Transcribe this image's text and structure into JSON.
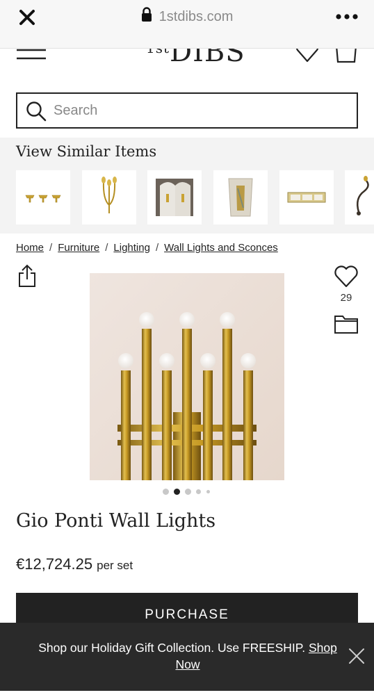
{
  "browser": {
    "url": "1stdibs.com",
    "icons": {
      "close": "close-icon",
      "lock": "lock-icon",
      "more": "more-icon"
    }
  },
  "header": {
    "logo_prefix": "1st",
    "logo_main": "DIBS",
    "icons": [
      "menu-icon",
      "heart-icon",
      "shopping-bag-icon"
    ]
  },
  "search": {
    "placeholder": "Search",
    "value": ""
  },
  "similar": {
    "title": "View Similar Items",
    "items": [
      "three-arm-sconce-set",
      "brass-triple-candle-sconce",
      "sconces-against-white-wall",
      "glass-panel-sconce",
      "horizontal-brass-bar-light",
      "curved-arm-sconce"
    ]
  },
  "breadcrumb": {
    "items": [
      "Home",
      "Furniture",
      "Lighting",
      "Wall Lights and Sconces"
    ],
    "separator": "/"
  },
  "product": {
    "favorites_count": "29",
    "title": "Gio Ponti Wall Lights",
    "price": "€12,724.25",
    "price_unit": "per set",
    "purchase_label": "PURCHASE",
    "image_index": 2,
    "image_count": 5
  },
  "promo": {
    "text": "Shop our Holiday Gift Collection. Use FREESHIP.",
    "link_label": "Shop Now"
  },
  "colors": {
    "dark": "#222222",
    "banner": "#2a2a2a",
    "muted": "#888888",
    "panel": "#f3f3f3",
    "brass": "#c9a233"
  }
}
